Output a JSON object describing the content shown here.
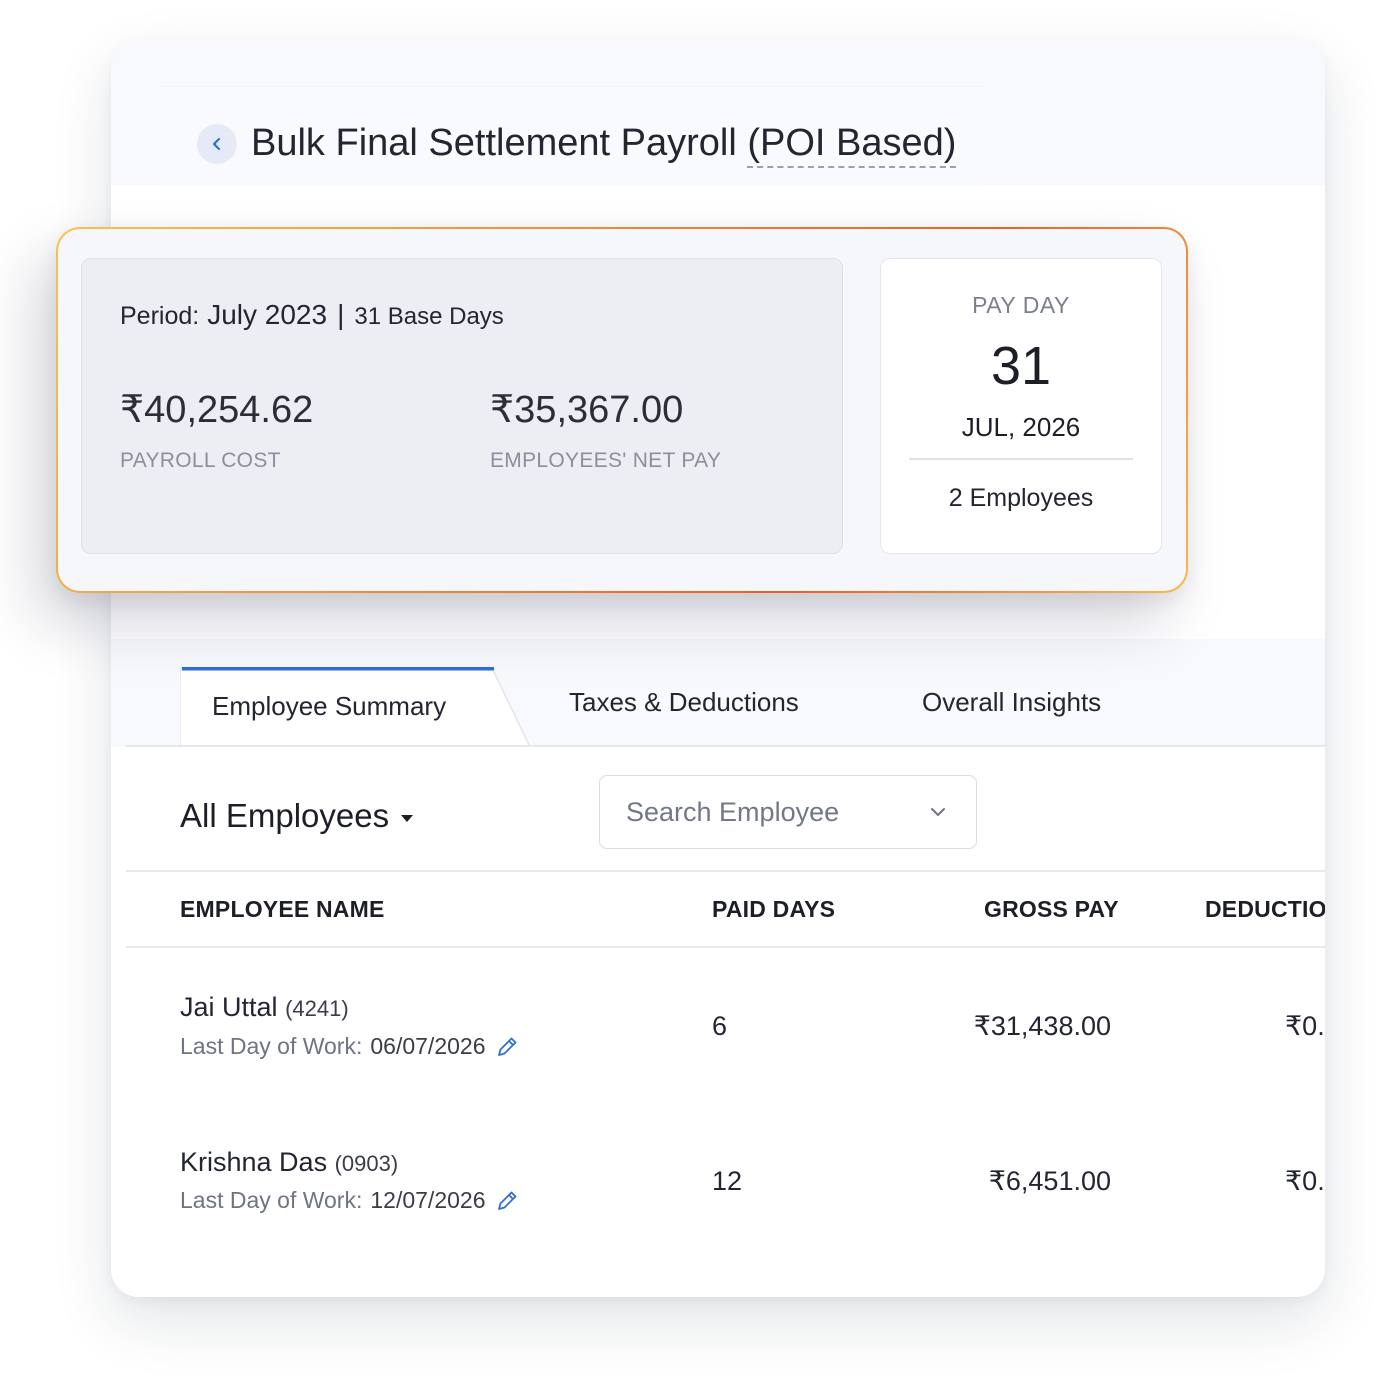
{
  "header": {
    "title": "Bulk Final Settlement Payroll",
    "title_qualifier": "(POI Based)"
  },
  "summary": {
    "period_label": "Period:",
    "period_month": "July 2023",
    "base_days": "31 Base Days",
    "payroll_cost": "₹40,254.62",
    "payroll_cost_label": "PAYROLL COST",
    "net_pay": "₹35,367.00",
    "net_pay_label": "EMPLOYEES' NET PAY"
  },
  "payday": {
    "label": "PAY DAY",
    "day": "31",
    "month_year": "JUL, 2026",
    "employees": "2 Employees"
  },
  "tabs": [
    {
      "label": "Employee Summary",
      "active": true
    },
    {
      "label": "Taxes & Deductions",
      "active": false
    },
    {
      "label": "Overall Insights",
      "active": false
    }
  ],
  "filters": {
    "employee_filter": "All Employees",
    "search_placeholder": "Search Employee"
  },
  "table": {
    "columns": [
      "EMPLOYEE NAME",
      "PAID DAYS",
      "GROSS PAY",
      "DEDUCTIO"
    ],
    "rows": [
      {
        "name": "Jai Uttal",
        "id": "(4241)",
        "last_day_label": "Last Day of Work:",
        "last_day": "06/07/2026",
        "paid_days": "6",
        "gross_pay": "₹31,438.00",
        "deductions": "₹0."
      },
      {
        "name": "Krishna Das",
        "id": "(0903)",
        "last_day_label": "Last Day of Work:",
        "last_day": "12/07/2026",
        "paid_days": "12",
        "gross_pay": "₹6,451.00",
        "deductions": "₹0."
      }
    ]
  },
  "colors": {
    "accent": "#2f6fd6",
    "text": "#232631",
    "muted": "#8b8f9c",
    "card_gradient_start": "#f7c24f",
    "card_gradient_mid": "#e95f2a"
  },
  "icons": {
    "back": "chevron-left-icon",
    "dropdown": "caret-down-icon",
    "search_dropdown": "chevron-down-icon",
    "edit": "pencil-icon"
  }
}
